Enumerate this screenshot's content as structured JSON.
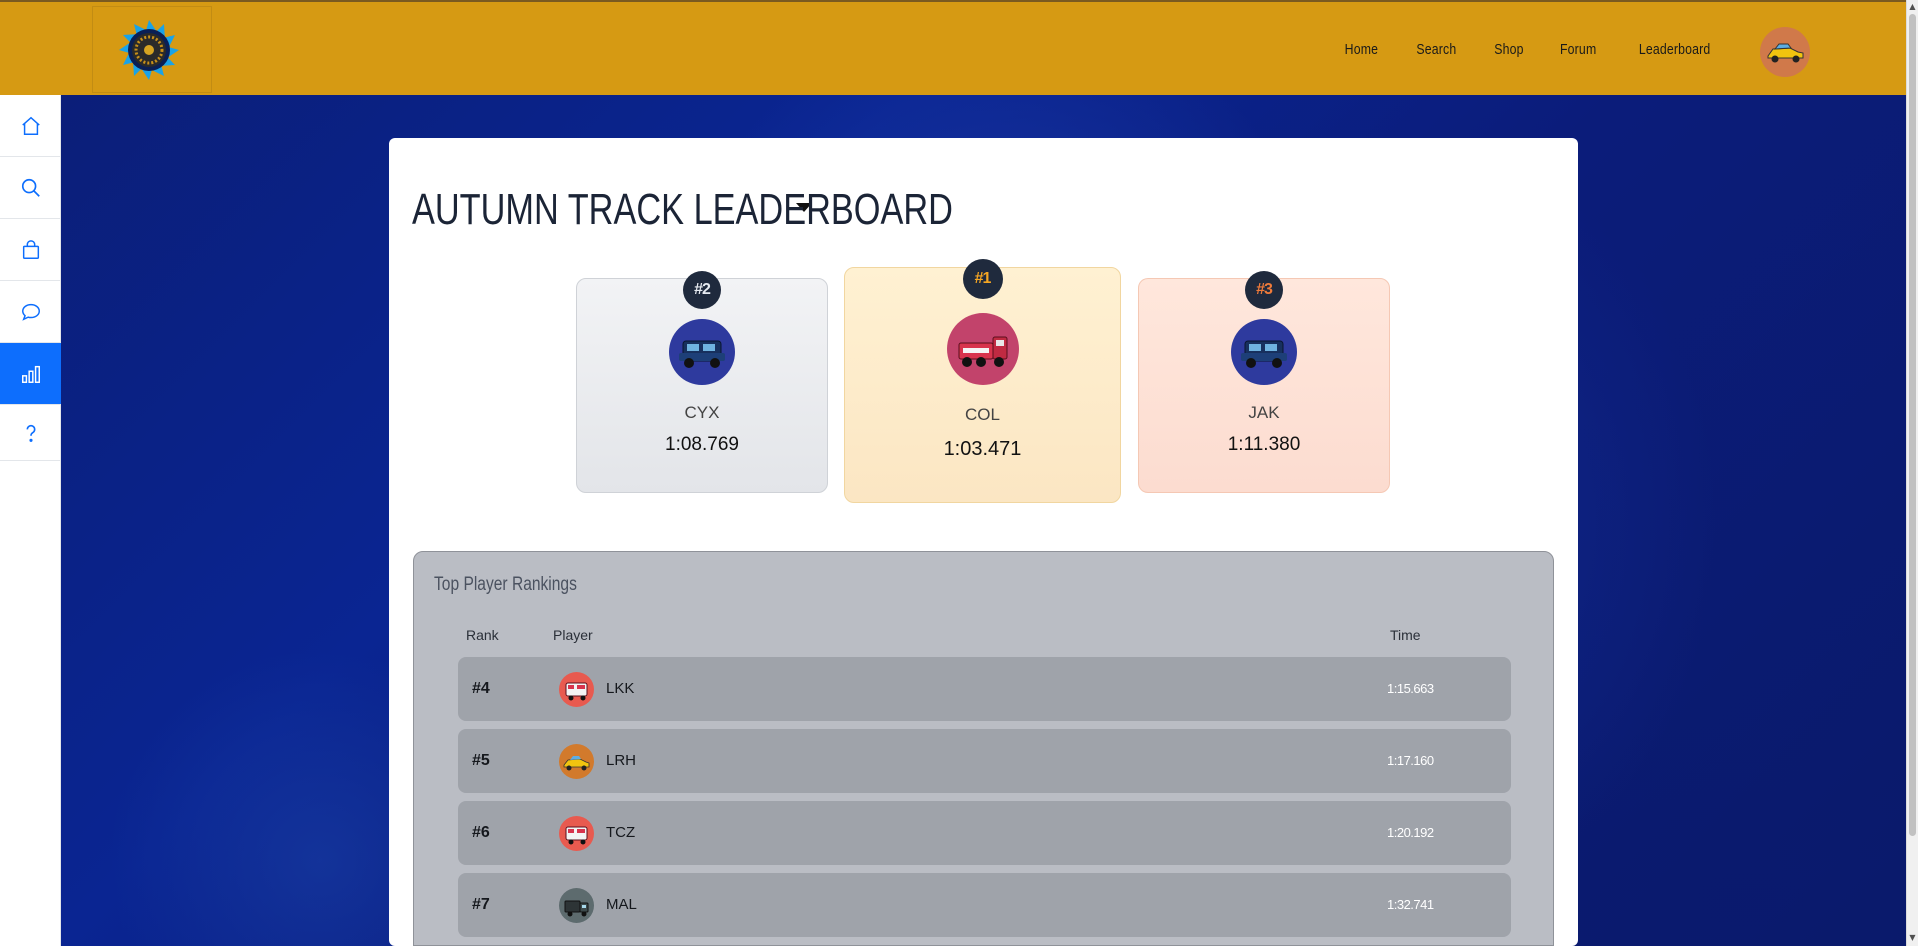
{
  "header": {
    "logo_icon": "spiral-wheel-logo",
    "nav": [
      {
        "label": "Home"
      },
      {
        "label": "Search"
      },
      {
        "label": "Shop"
      },
      {
        "label": "Forum"
      },
      {
        "label": "Leaderboard"
      }
    ],
    "avatar_icon": "car-avatar"
  },
  "sidebar": {
    "items": [
      {
        "icon": "home-icon",
        "active": false
      },
      {
        "icon": "search-icon",
        "active": false
      },
      {
        "icon": "shopping-bag-icon",
        "active": false
      },
      {
        "icon": "chat-bubble-icon",
        "active": false
      },
      {
        "icon": "bar-chart-icon",
        "active": true
      },
      {
        "icon": "question-icon",
        "active": false
      }
    ],
    "active_color": "#0d6efd"
  },
  "leaderboard": {
    "title": "AUTUMN TRACK LEADERBOARD",
    "podium": [
      {
        "rank": "#2",
        "name": "CYX",
        "time": "1:08.769",
        "avatar": "blue-jeep-icon"
      },
      {
        "rank": "#1",
        "name": "COL",
        "time": "1:03.471",
        "avatar": "pink-truck-icon"
      },
      {
        "rank": "#3",
        "name": "JAK",
        "time": "1:11.380",
        "avatar": "blue-jeep-icon"
      }
    ],
    "rankings": {
      "title": "Top Player Rankings",
      "headers": {
        "rank": "Rank",
        "player": "Player",
        "time": "Time"
      },
      "rows": [
        {
          "rank": "#4",
          "name": "LKK",
          "time": "1:15.663",
          "avatar": "red-van-icon"
        },
        {
          "rank": "#5",
          "name": "LRH",
          "time": "1:17.160",
          "avatar": "yellow-car-icon"
        },
        {
          "rank": "#6",
          "name": "TCZ",
          "time": "1:20.192",
          "avatar": "red-van-icon"
        },
        {
          "rank": "#7",
          "name": "MAL",
          "time": "1:32.741",
          "avatar": "gray-truck-icon"
        }
      ]
    }
  },
  "colors": {
    "topbar": "#d69a13",
    "gold": "#f5a623",
    "bronze": "#f07b3a",
    "badge_bg": "#1f2a3d"
  }
}
